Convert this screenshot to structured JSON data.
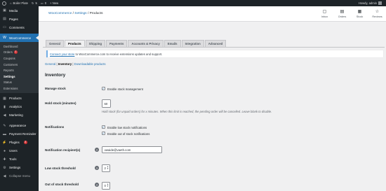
{
  "adminbar": {
    "site_name": "Boiler Plate",
    "updates_count": "5",
    "comments_count": "0",
    "new_label": "+ New",
    "howdy": "Howdy, admin"
  },
  "sidebar": {
    "top_items": [
      {
        "label": "Media",
        "icon": "media-icon"
      },
      {
        "label": "Pages",
        "icon": "pages-icon"
      },
      {
        "label": "Comments",
        "icon": "comments-icon"
      }
    ],
    "woo_label": "WooCommerce",
    "submenu": [
      {
        "label": "Dashboard"
      },
      {
        "label": "Orders",
        "badge": "1"
      },
      {
        "label": "Coupons"
      },
      {
        "label": "Customers"
      },
      {
        "label": "Reports"
      },
      {
        "label": "Settings"
      },
      {
        "label": "Status"
      },
      {
        "label": "Extensions"
      }
    ],
    "bottom_items": [
      {
        "label": "Products",
        "icon": "products-icon"
      },
      {
        "label": "Analytics",
        "icon": "analytics-icon"
      },
      {
        "label": "Marketing",
        "icon": "marketing-icon"
      },
      {
        "label": "Appearance",
        "icon": "appearance-icon"
      },
      {
        "label": "Payment Reminder",
        "icon": "payment-icon"
      },
      {
        "label": "Plugins",
        "icon": "plugins-icon",
        "badge": "3"
      },
      {
        "label": "Users",
        "icon": "users-icon"
      },
      {
        "label": "Tools",
        "icon": "tools-icon"
      },
      {
        "label": "Settings",
        "icon": "settings-icon"
      },
      {
        "label": "Collapse menu",
        "icon": "collapse-icon"
      }
    ]
  },
  "header": {
    "breadcrumb": [
      "WooCommerce",
      "Settings",
      "Products"
    ],
    "activity": [
      {
        "label": "Inbox",
        "icon": "inbox-icon"
      },
      {
        "label": "Orders",
        "icon": "orders-icon"
      },
      {
        "label": "Stock",
        "icon": "stock-icon"
      },
      {
        "label": "Reviews",
        "icon": "reviews-icon"
      }
    ]
  },
  "tabs": [
    "General",
    "Products",
    "Shipping",
    "Payments",
    "Accounts & Privacy",
    "Emails",
    "Integration",
    "Advanced"
  ],
  "notice": {
    "link": "Connect your store",
    "text": " to WooCommerce.com to receive extensions updates and support."
  },
  "subsections": {
    "general": "General",
    "inventory": "Inventory",
    "downloadable": "Downloadable products"
  },
  "form": {
    "title": "Inventory",
    "manage_stock": {
      "label": "Manage stock",
      "option": "Enable stock management"
    },
    "hold_stock": {
      "label": "Hold stock (minutes)",
      "value": "60",
      "desc": "Hold stock (for unpaid orders) for x minutes. When this limit is reached, the pending order will be cancelled. Leave blank to disable."
    },
    "notifications": {
      "label": "Notifications",
      "option1": "Enable low stock notifications",
      "option2": "Enable out of stock notifications"
    },
    "recipient": {
      "label": "Notification recipient(s)",
      "value": "owaide@vaeth.com"
    },
    "low_threshold": {
      "label": "Low stock threshold",
      "value": "2"
    },
    "out_threshold": {
      "label": "Out of stock threshold",
      "value": "0"
    }
  },
  "colors": {
    "admin_dark": "#1d2327",
    "accent": "#2271b1"
  }
}
